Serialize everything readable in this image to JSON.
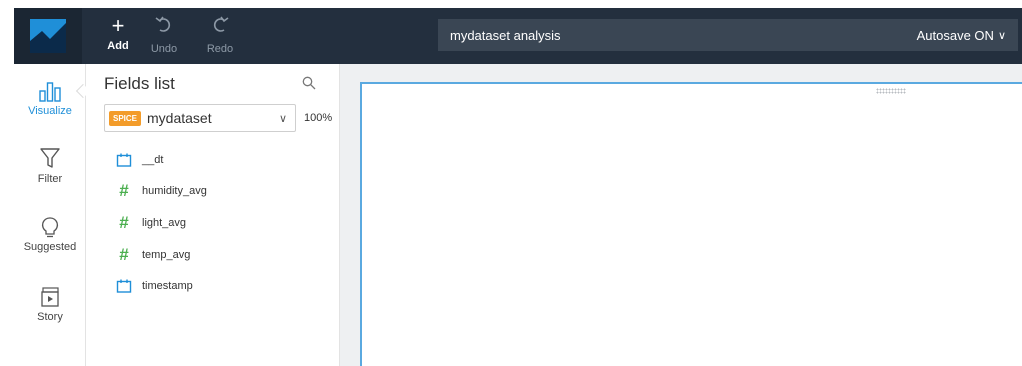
{
  "toolbar": {
    "add_label": "Add",
    "undo_label": "Undo",
    "redo_label": "Redo"
  },
  "analysis": {
    "title": "mydataset analysis",
    "autosave": "Autosave ON"
  },
  "nav": {
    "items": [
      {
        "label": "Visualize",
        "icon": "bar-chart-icon",
        "active": true
      },
      {
        "label": "Filter",
        "icon": "funnel-icon",
        "active": false
      },
      {
        "label": "Suggested",
        "icon": "lightbulb-icon",
        "active": false
      },
      {
        "label": "Story",
        "icon": "story-icon",
        "active": false
      }
    ]
  },
  "fields_panel": {
    "title": "Fields list",
    "dataset_badge": "SPICE",
    "dataset_name": "mydataset",
    "spice_usage": "100%",
    "fields": [
      {
        "name": "__dt",
        "type": "date"
      },
      {
        "name": "humidity_avg",
        "type": "measure"
      },
      {
        "name": "light_avg",
        "type": "measure"
      },
      {
        "name": "temp_avg",
        "type": "measure"
      },
      {
        "name": "timestamp",
        "type": "date"
      }
    ]
  },
  "colors": {
    "topbar": "#232f3e",
    "accent": "#1f8fd8",
    "spice": "#f39c2a",
    "measure": "#4caf50"
  }
}
